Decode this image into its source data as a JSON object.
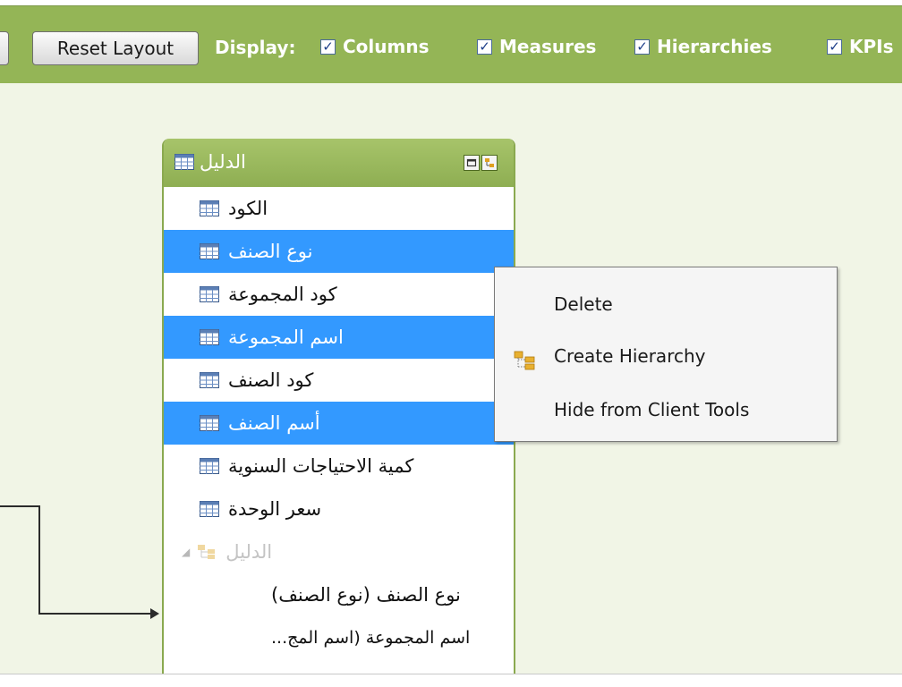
{
  "toolbar": {
    "reset_label": "Reset Layout",
    "display_label": "Display:",
    "checks": [
      {
        "label": "Columns",
        "checked": true
      },
      {
        "label": "Measures",
        "checked": true
      },
      {
        "label": "Hierarchies",
        "checked": true
      },
      {
        "label": "KPIs",
        "checked": true
      }
    ]
  },
  "table": {
    "title": "الدليل",
    "columns": [
      {
        "label": "الكود",
        "selected": false
      },
      {
        "label": "نوع الصنف",
        "selected": true
      },
      {
        "label": "كود المجموعة",
        "selected": false
      },
      {
        "label": "اسم المجموعة",
        "selected": true
      },
      {
        "label": "كود الصنف",
        "selected": false
      },
      {
        "label": "أسم الصنف",
        "selected": true
      },
      {
        "label": "كمية الاحتياجات السنوية",
        "selected": false
      },
      {
        "label": "سعر الوحدة",
        "selected": false
      }
    ],
    "hierarchy": {
      "label": "الدليل",
      "levels": [
        "نوع الصنف (نوع الصنف)",
        "اسم المجموعة (اسم المج..."
      ]
    }
  },
  "context_menu": {
    "items": [
      "Delete",
      "Create Hierarchy",
      "Hide from Client Tools"
    ]
  },
  "colors": {
    "toolbar": "#94b556",
    "canvas": "#f1f5e6",
    "selection": "#3399ff",
    "table_border": "#8aa94f"
  }
}
